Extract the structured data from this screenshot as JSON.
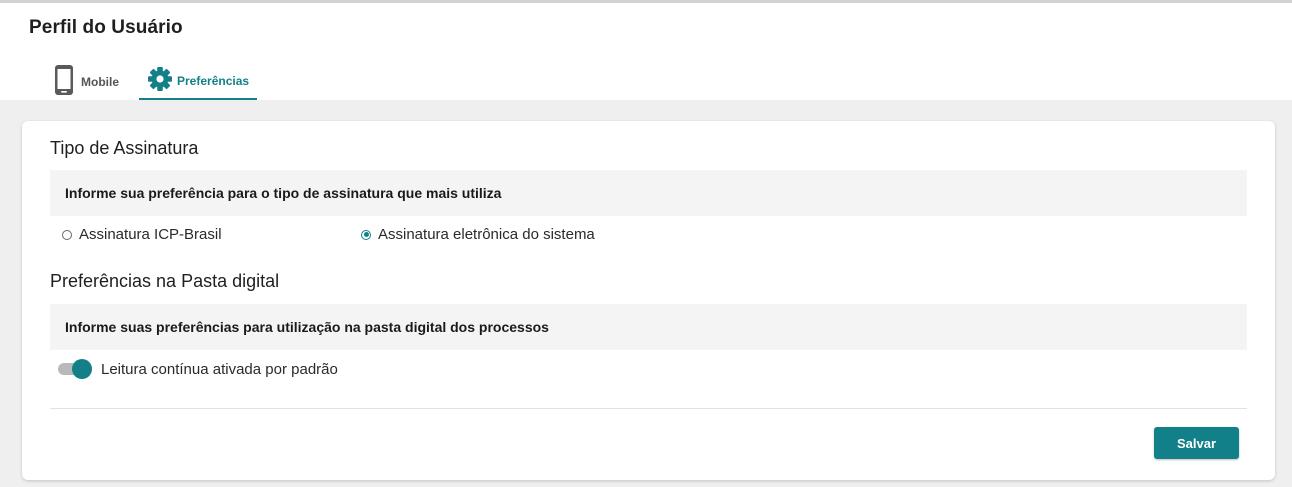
{
  "page": {
    "title": "Perfil do Usuário"
  },
  "tabs": [
    {
      "label": "Mobile",
      "icon": "mobile-phone-icon",
      "active": false
    },
    {
      "label": "Preferências",
      "icon": "gear-icon",
      "active": true
    }
  ],
  "signature": {
    "title": "Tipo de Assinatura",
    "info": "Informe sua preferência para o tipo de assinatura que mais utiliza",
    "options": [
      {
        "label": "Assinatura ICP-Brasil",
        "selected": false
      },
      {
        "label": "Assinatura eletrônica do sistema",
        "selected": true
      }
    ]
  },
  "folder": {
    "title": "Preferências na Pasta digital",
    "info": "Informe suas preferências para utilização na pasta digital dos processos",
    "toggle_label": "Leitura contínua ativada por padrão",
    "toggle_on": true
  },
  "actions": {
    "save_label": "Salvar"
  },
  "colors": {
    "accent": "#138089",
    "background": "#efefef",
    "card": "#ffffff"
  }
}
